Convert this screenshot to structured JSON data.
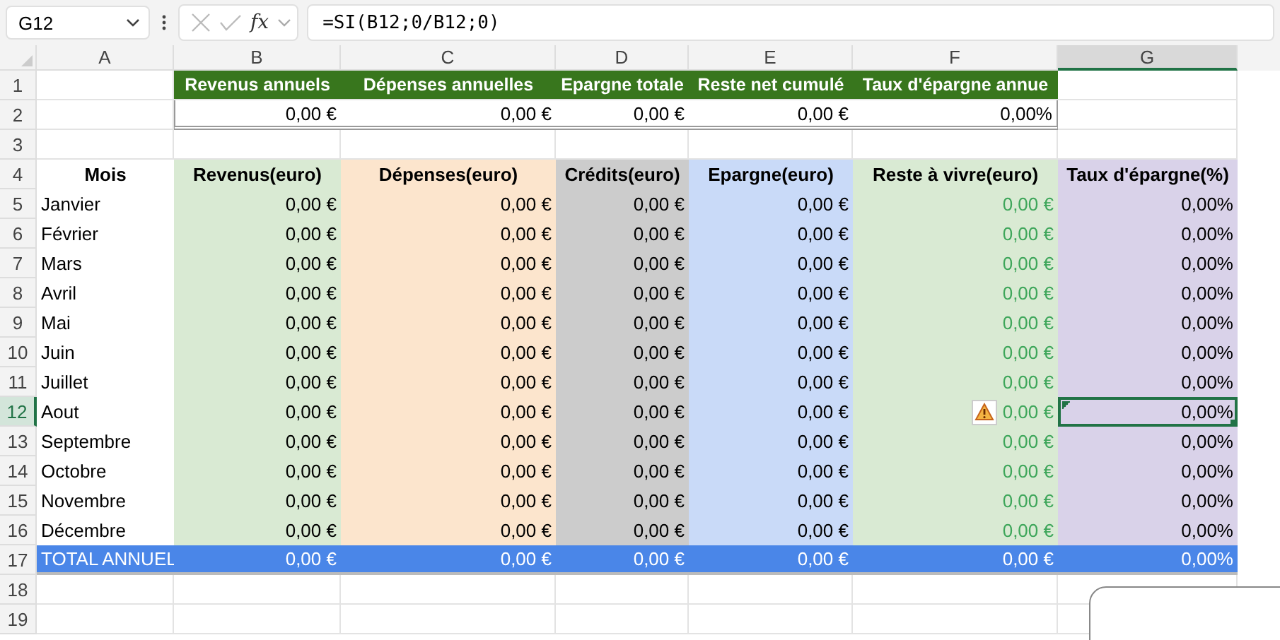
{
  "formula_bar": {
    "name_box": "G12",
    "function_label": "fx",
    "formula": "=SI(B12;0/B12;0)"
  },
  "column_headers": [
    {
      "label": "A",
      "selected": false
    },
    {
      "label": "B",
      "selected": false
    },
    {
      "label": "C",
      "selected": false
    },
    {
      "label": "D",
      "selected": false
    },
    {
      "label": "E",
      "selected": false
    },
    {
      "label": "F",
      "selected": false
    },
    {
      "label": "G",
      "selected": true
    }
  ],
  "row_headers": [
    {
      "label": "1",
      "selected": false
    },
    {
      "label": "2",
      "selected": false
    },
    {
      "label": "3",
      "selected": false
    },
    {
      "label": "4",
      "selected": false
    },
    {
      "label": "5",
      "selected": false
    },
    {
      "label": "6",
      "selected": false
    },
    {
      "label": "7",
      "selected": false
    },
    {
      "label": "8",
      "selected": false
    },
    {
      "label": "9",
      "selected": false
    },
    {
      "label": "10",
      "selected": false
    },
    {
      "label": "11",
      "selected": false
    },
    {
      "label": "12",
      "selected": true
    },
    {
      "label": "13",
      "selected": false
    },
    {
      "label": "14",
      "selected": false
    },
    {
      "label": "15",
      "selected": false
    },
    {
      "label": "16",
      "selected": false
    },
    {
      "label": "17",
      "selected": false
    },
    {
      "label": "18",
      "selected": false
    },
    {
      "label": "19",
      "selected": false
    }
  ],
  "summary": {
    "headers": [
      "Revenus annuels",
      "Dépenses annuelles",
      "Epargne totale",
      "Reste net cumulé",
      "Taux d'épargne annue"
    ],
    "values": [
      "0,00 €",
      "0,00 €",
      "0,00 €",
      "0,00 €",
      "0,00%"
    ]
  },
  "table": {
    "columns": [
      {
        "label": "Mois",
        "color": "#ffffff"
      },
      {
        "label": "Revenus(euro)",
        "color": "#d9ead3"
      },
      {
        "label": "Dépenses(euro)",
        "color": "#fce5cd"
      },
      {
        "label": "Crédits(euro)",
        "color": "#cccccc"
      },
      {
        "label": "Epargne(euro)",
        "color": "#c9daf8"
      },
      {
        "label": "Reste à vivre(euro)",
        "color": "#d9ead3"
      },
      {
        "label": "Taux d'épargne(%)",
        "color": "#d9d2e9"
      }
    ],
    "rows": [
      {
        "month": "Janvier",
        "values": [
          "0,00 €",
          "0,00 €",
          "0,00 €",
          "0,00 €",
          "0,00 €",
          "0,00%"
        ],
        "warning": false,
        "selected": false
      },
      {
        "month": "Février",
        "values": [
          "0,00 €",
          "0,00 €",
          "0,00 €",
          "0,00 €",
          "0,00 €",
          "0,00%"
        ],
        "warning": false,
        "selected": false
      },
      {
        "month": "Mars",
        "values": [
          "0,00 €",
          "0,00 €",
          "0,00 €",
          "0,00 €",
          "0,00 €",
          "0,00%"
        ],
        "warning": false,
        "selected": false
      },
      {
        "month": "Avril",
        "values": [
          "0,00 €",
          "0,00 €",
          "0,00 €",
          "0,00 €",
          "0,00 €",
          "0,00%"
        ],
        "warning": false,
        "selected": false
      },
      {
        "month": "Mai",
        "values": [
          "0,00 €",
          "0,00 €",
          "0,00 €",
          "0,00 €",
          "0,00 €",
          "0,00%"
        ],
        "warning": false,
        "selected": false
      },
      {
        "month": "Juin",
        "values": [
          "0,00 €",
          "0,00 €",
          "0,00 €",
          "0,00 €",
          "0,00 €",
          "0,00%"
        ],
        "warning": false,
        "selected": false
      },
      {
        "month": "Juillet",
        "values": [
          "0,00 €",
          "0,00 €",
          "0,00 €",
          "0,00 €",
          "0,00 €",
          "0,00%"
        ],
        "warning": false,
        "selected": false
      },
      {
        "month": "Aout",
        "values": [
          "0,00 €",
          "0,00 €",
          "0,00 €",
          "0,00 €",
          "0,00 €",
          "0,00%"
        ],
        "warning": true,
        "selected": true
      },
      {
        "month": "Septembre",
        "values": [
          "0,00 €",
          "0,00 €",
          "0,00 €",
          "0,00 €",
          "0,00 €",
          "0,00%"
        ],
        "warning": false,
        "selected": false
      },
      {
        "month": "Octobre",
        "values": [
          "0,00 €",
          "0,00 €",
          "0,00 €",
          "0,00 €",
          "0,00 €",
          "0,00%"
        ],
        "warning": false,
        "selected": false
      },
      {
        "month": "Novembre",
        "values": [
          "0,00 €",
          "0,00 €",
          "0,00 €",
          "0,00 €",
          "0,00 €",
          "0,00%"
        ],
        "warning": false,
        "selected": false
      },
      {
        "month": "Décembre",
        "values": [
          "0,00 €",
          "0,00 €",
          "0,00 €",
          "0,00 €",
          "0,00 €",
          "0,00%"
        ],
        "warning": false,
        "selected": false
      }
    ],
    "total": {
      "label": "TOTAL ANNUEL",
      "values": [
        "0,00 €",
        "0,00 €",
        "0,00 €",
        "0,00 €",
        "0,00 €",
        "0,00%"
      ]
    }
  }
}
